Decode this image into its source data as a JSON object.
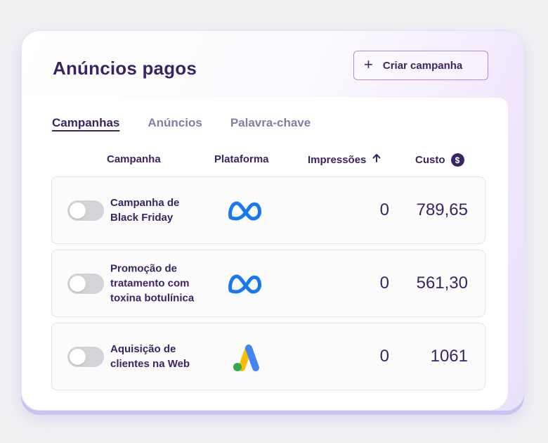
{
  "header": {
    "title": "Anúncios pagos",
    "create_button_label": "Criar campanha"
  },
  "tabs": [
    {
      "label": "Campanhas",
      "active": true
    },
    {
      "label": "Anúncios",
      "active": false
    },
    {
      "label": "Palavra-chave",
      "active": false
    }
  ],
  "columns": {
    "campaign": "Campanha",
    "platform": "Plataforma",
    "impressions": "Impressões",
    "cost": "Custo"
  },
  "icons": {
    "sort": "arrow-up-icon",
    "currency": "dollar-coin-icon",
    "create": "plus-icon"
  },
  "rows": [
    {
      "name": "Campanha de Black Friday",
      "platform": "meta-icon",
      "impressions": "0",
      "cost": "789,65",
      "enabled": false
    },
    {
      "name": "Promoção de tratamento com toxina botulínica",
      "platform": "meta-icon",
      "impressions": "0",
      "cost": "561,30",
      "enabled": false
    },
    {
      "name": "Aquisição de clientes na Web",
      "platform": "google-ads-icon",
      "impressions": "0",
      "cost": "1061",
      "enabled": false
    }
  ],
  "colors": {
    "primary_text": "#3b2463",
    "inactive_tab": "#8a7aa6",
    "meta_blue": "#1877f2",
    "toggle_off": "#d4d4d8"
  }
}
